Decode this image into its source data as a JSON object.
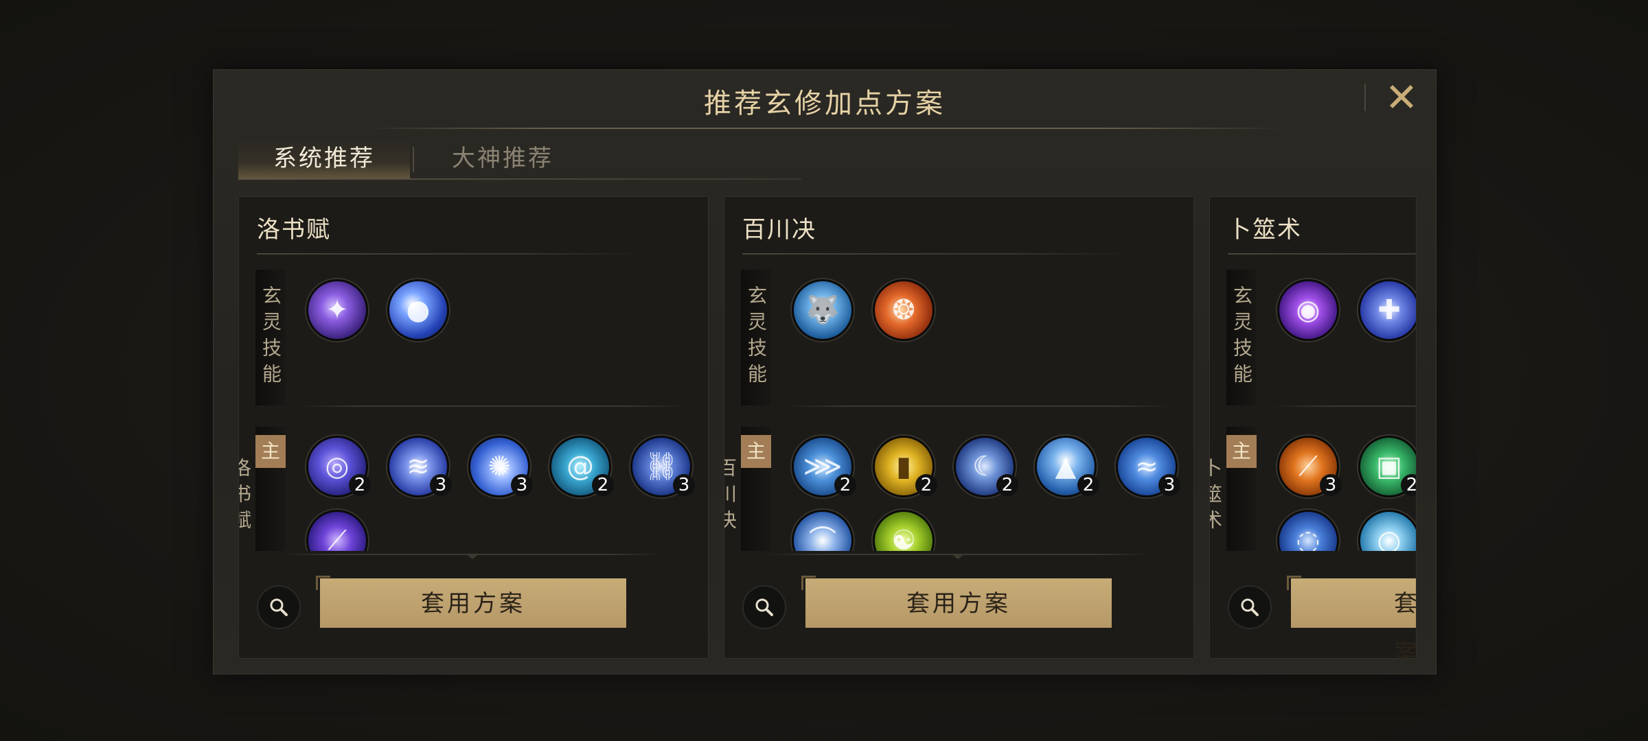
{
  "dialog": {
    "title": "推荐玄修加点方案",
    "close_icon": "close-icon"
  },
  "tabs": [
    {
      "label": "系统推荐",
      "active": true
    },
    {
      "label": "大神推荐",
      "active": false
    }
  ],
  "cards": [
    {
      "name": "洛书赋",
      "section1_label": "玄灵技能",
      "section2_mark": "主",
      "section2_label": "洛书赋",
      "apply_label": "套用方案",
      "row1": [
        {
          "icon": "purple-lightning-sphere-icon",
          "color": "#5e3ba8"
        },
        {
          "icon": "blue-comet-icon",
          "color": "#2d4fc4"
        }
      ],
      "row2": [
        {
          "icon": "blue-spiral-dragon-icon",
          "color": "#4b48c7",
          "level": "2"
        },
        {
          "icon": "white-claw-slash-icon",
          "color": "#3a52c9",
          "level": "3"
        },
        {
          "icon": "blue-impact-burst-icon",
          "color": "#3c66d6",
          "level": "3"
        },
        {
          "icon": "cyan-vortex-icon",
          "color": "#2a8fb3",
          "level": "2"
        },
        {
          "icon": "ice-chain-icon",
          "color": "#3157b0",
          "level": "3"
        },
        {
          "icon": "purple-blade-rain-icon",
          "color": "#5a36b5",
          "level": ""
        }
      ]
    },
    {
      "name": "百川决",
      "section1_label": "玄灵技能",
      "section2_mark": "主",
      "section2_label": "百川决",
      "apply_label": "套用方案",
      "row1": [
        {
          "icon": "frost-wolf-icon",
          "color": "#2b7fc0"
        },
        {
          "icon": "flame-swirl-icon",
          "color": "#c04a1a"
        }
      ],
      "row2": [
        {
          "icon": "ice-dragon-icon",
          "color": "#2a68b8",
          "level": "2"
        },
        {
          "icon": "golden-pillar-icon",
          "color": "#c9a21e",
          "level": "2"
        },
        {
          "icon": "crescent-moon-icon",
          "color": "#3e6fbf",
          "level": "2"
        },
        {
          "icon": "ice-spike-icon",
          "color": "#3a84cf",
          "level": "2"
        },
        {
          "icon": "water-wave-icon",
          "color": "#2e6fc6",
          "level": "3"
        },
        {
          "icon": "waterfall-icon",
          "color": "#4a7ecf",
          "level": ""
        },
        {
          "icon": "green-rune-orb-icon",
          "color": "#7fa81c",
          "level": ""
        }
      ]
    },
    {
      "name": "卜筮术",
      "section1_label": "玄灵技能",
      "section2_mark": "主",
      "section2_label": "卜筮术",
      "apply_label": "套用方案",
      "row1": [
        {
          "icon": "violet-eye-orb-icon",
          "color": "#7a2fc4"
        },
        {
          "icon": "blue-cross-star-icon",
          "color": "#3f59c9"
        }
      ],
      "row2": [
        {
          "icon": "orange-slash-icon",
          "color": "#c25f16",
          "level": "3"
        },
        {
          "icon": "green-talisman-icon",
          "color": "#2f9a5a",
          "level": "2"
        },
        {
          "icon": "blue-energy-ring-icon",
          "color": "#2b62c4",
          "level": ""
        },
        {
          "icon": "cyan-full-moon-icon",
          "color": "#3c9fcf",
          "level": ""
        }
      ]
    }
  ],
  "search_icon": "magnifier-icon",
  "colors": {
    "accent_gold": "#c7ac78",
    "title_gold": "#e6d3a6",
    "panel_bg": "#1c1b18"
  }
}
